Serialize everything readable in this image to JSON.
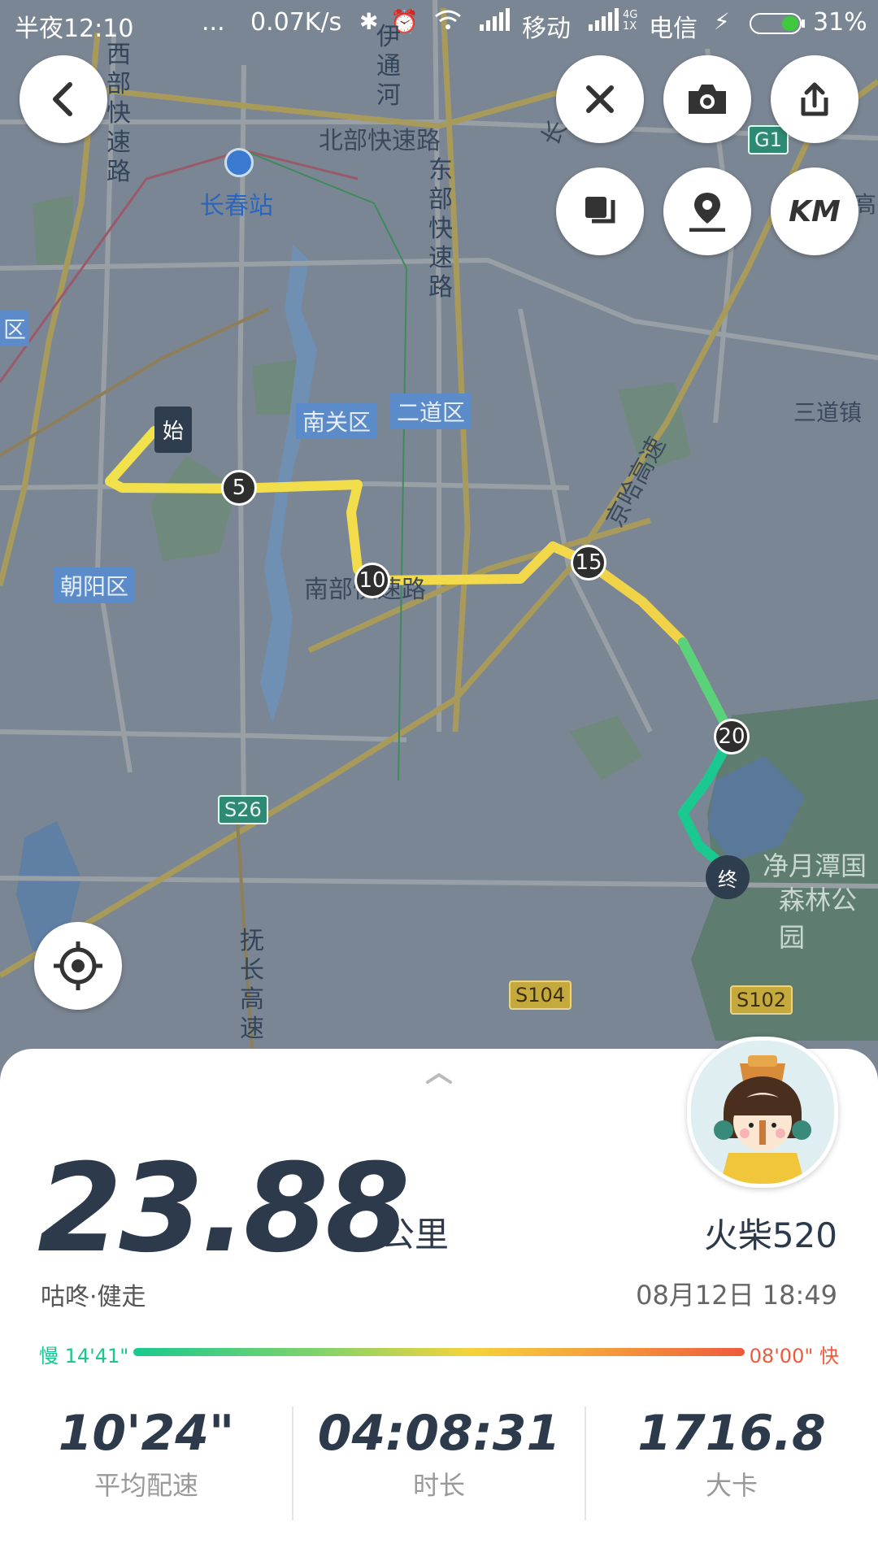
{
  "status_bar": {
    "time": "半夜12:10",
    "dots": "...",
    "speed": "0.07K/s",
    "carrier1": "移动",
    "network_badge": "4G\n1X",
    "carrier2": "电信",
    "battery": "31%"
  },
  "toolbar": {
    "back_icon": "chevron-left-icon",
    "close_icon": "close-icon",
    "camera_icon": "camera-icon",
    "share_icon": "share-icon",
    "layers_icon": "layers-icon",
    "location_pin_icon": "location-pin-icon",
    "km_label": "KM",
    "locate_icon": "crosshair-icon"
  },
  "map": {
    "labels": {
      "west_expressway": "西部快速路",
      "north_expressway": "北部快速路",
      "east_expressway": "东部快速路",
      "yitong_river": "伊通河",
      "changchun_station": "长春站",
      "south_expressway": "南部快速路",
      "sandao_town": "三道镇",
      "jingha_highway": "京哈高速",
      "fuchang_highway": "抚长高速",
      "jingyuetan_line1": "净月潭国",
      "jingyuetan_line2": "森林公园",
      "chang_fragment": "长",
      "gao_fragment": "高",
      "district_fragment": "区"
    },
    "districts": {
      "nanguan": "南关区",
      "erdao": "二道区",
      "chaoyang": "朝阳区"
    },
    "shields": {
      "g1": "G1",
      "s26": "S26",
      "s104": "S104",
      "s102": "S102"
    },
    "route": {
      "start_label": "始",
      "end_label": "终",
      "km_markers": [
        "5",
        "10",
        "15",
        "20"
      ]
    }
  },
  "summary": {
    "distance": "23.88",
    "unit": "公里",
    "activity": "咕咚·健走",
    "username": "火柴520",
    "datetime": "08月12日 18:49",
    "pace_slow": "慢 14'41\"",
    "pace_fast": "08'00\" 快",
    "expand_icon": "chevron-up-icon",
    "avatar_icon": "avatar-icon"
  },
  "stats": [
    {
      "value": "10'24\"",
      "label": "平均配速"
    },
    {
      "value": "04:08:31",
      "label": "时长"
    },
    {
      "value": "1716.8",
      "label": "大卡"
    }
  ]
}
